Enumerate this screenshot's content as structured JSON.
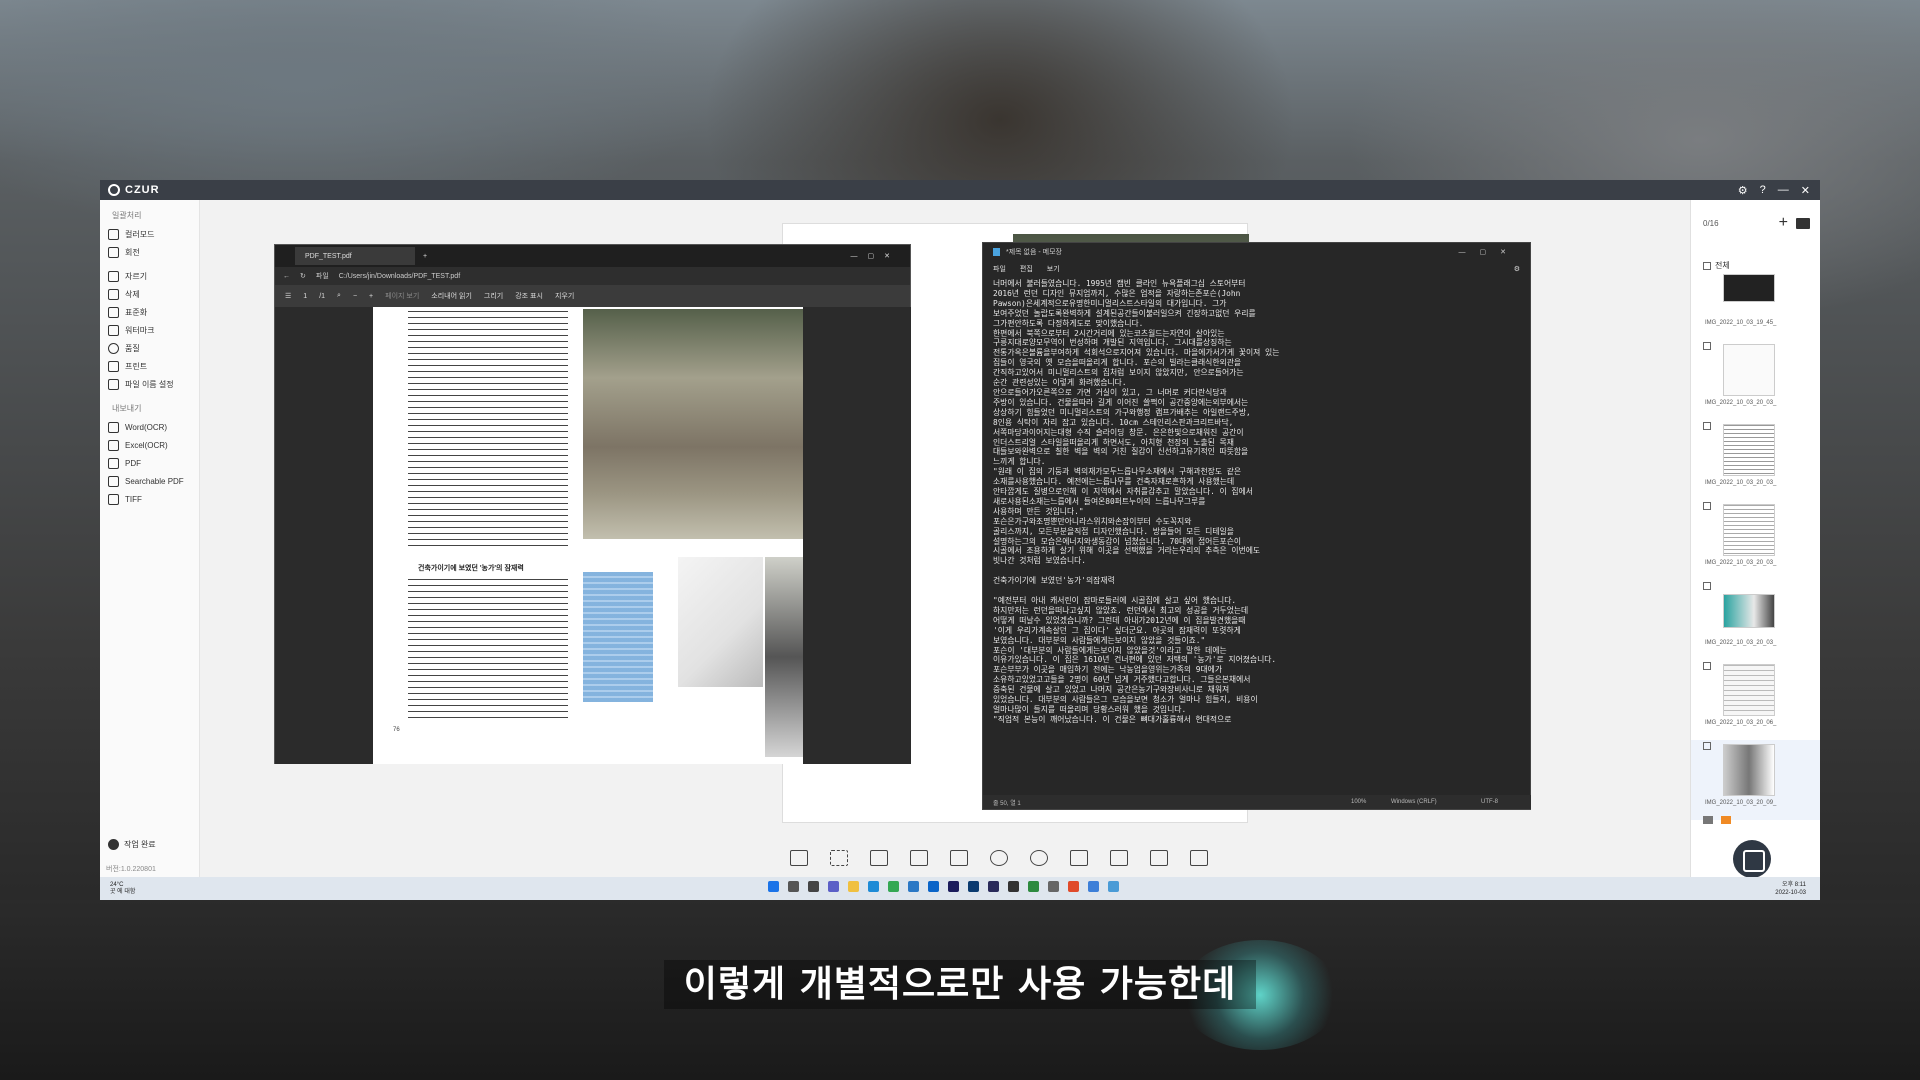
{
  "app": {
    "brand": "CZUR",
    "window_controls": [
      "⚙",
      "?",
      "—",
      "✕"
    ]
  },
  "sidebar": {
    "processing_header": "일괄처리",
    "processing_items": [
      "컬러모드",
      "회전",
      "자르기",
      "삭제",
      "표준화",
      "워터마크",
      "품질",
      "프린트",
      "파일 이름 설정"
    ],
    "export_header": "내보내기",
    "export_items": [
      "Word(OCR)",
      "Excel(OCR)",
      "PDF",
      "Searchable PDF",
      "TIFF"
    ],
    "task_done": "작업 완료",
    "version": "버전:1.0.220801"
  },
  "thumbnails": {
    "count": "0/16",
    "select_all": "전체",
    "items": [
      "IMG_2022_10_03_19_45_",
      "IMG_2022_10_03_20_03_",
      "IMG_2022_10_03_20_03_",
      "IMG_2022_10_03_20_03_",
      "IMG_2022_10_03_20_03_",
      "IMG_2022_10_03_20_06_",
      "IMG_2022_10_03_20_09_"
    ],
    "scan_label": "스캔"
  },
  "pdf_viewer": {
    "tab_title": "PDF_TEST.pdf",
    "address_prefix": "파일",
    "address": "C:/Users/jin/Downloads/PDF_TEST.pdf",
    "page_number": "1",
    "page_total": "/1",
    "tools": [
      "페이지 보기",
      "소리내어 읽기",
      "그리기",
      "강조 표시",
      "지우기"
    ],
    "heading": "건축가이기에 보였던 '농가'의 잠재력",
    "page_footer": "76"
  },
  "notepad": {
    "title": "*제목 없음 - 메모장",
    "menu": [
      "파일",
      "편집",
      "보기"
    ],
    "body": "너머에서 불러들였습니다. 1995년 캠빈 클라인 뉴욕플래그십 스토어부터\n2016년 런던 디자인 뮤지엄까지, 수많은 업적을 자랑하는존포슨(John\nPawson)은세계적으로유명한미니멀리스트스타일의 대가입니다. 그가\n보여주었던 놀랍도록완벽하게 설계된공간들이불러일으켜 긴장하고없던 우리를\n그가편안하도록 다정하게도로 맞이했습니다.\n한편에서 북쪽으로부터 2시간거리에 있는코츠월드는자연이 살아있는\n구릉지대로양모무역이 번성하며 개발된 지역입니다. 그시대를상징하는\n전통가옥은볼륨을부여하게 석회석으로지어져 있습니다. 마을에가서가게 꽃이져 있는\n집들이 영국의 옛 모습을떠올리게 합니다. 포슨의 빌라는클래식한외관을\n간직하고있어서 미니멀리스트의 집처럼 보이지 않았지만, 안으로들어가는\n순간 관련성있는 이렇게 화려했습니다.\n안으로들어가오른쪽으로 가면 거실이 있고, 그 너머로 커다란식당과\n주방이 있습니다. 건물을따라 길게 이어진 쓸쩍이 공간중앙에는외부에서는\n상상하기 힘들었던 미니멀리스트의 가구와행정 램프가배추는 아일랜드주방,\n8인용 식탁이 자리 잡고 있습니다. 10cm 스테인리스판과크리트바닥,\n서쪽마당과이어지는대형 수직 슬라이딩 창문. 은은한빛으로채워진 공간이\n인더스트리얼 스타일을떠올리게 하면서도, 아치형 천장의 노출된 목재\n대들보와완벽으로 칠한 벽을 벽의 거친 질감이 신선하고유기적인 따뜻함을\n느끼게 합니다.\n\"원래 이 집의 기둥과 벽의재가모두느릅나무소재에서 구해과천장도 같은\n소재를사용했습니다. 예전에는느릅나무를 건축자재로흔하게 사용했는데\n안타깝게도 질병으로인해 이 지역에서 자취를감추고 말았습니다. 이 집에서\n새로사용된소재는느릅에서 들여온80퍼트누이의 느릅나무그루를\n사용하며 만든 것입니다.\"\n포슨은가구와조명뿐만아니라스위치와손잡이부터 수도꼭지와\n골리스까지, 모든부분을직접 디자인했습니다. 방을들어 모든 디테일을\n설명하는그의 모습은에너지와생동감이 넘쳤습니다. 70대에 접어든포슨이\n시골에서 조용하게 살기 위해 이곳을 선택했을 거라는우리의 추측은 이번에도\n빗나간 것처럼 보였습니다.\n\n건축가이기에 보였던'농가'의잠재력\n\n\"예전부터 아내 캐서린이 잠마로들러에 시골집에 살고 싶어 했습니다.\n하지만저는 런던을떠나고싶지 않았죠. 런던에서 최고의 성공을 거두었는데\n어떻게 떠날수 있었겠습니까? 그런데 아내가2012년에 이 집을발견했을때\n'이게 우리가계속살던 그 집이다' 싶더군요. 아곳의 잠재력이 또렷하게\n보였습니다. 대부분의 사람들에게는보이지 않았을 것들이죠.\"\n포슨이 '대부분의 사람들에게는보이지 않았을것'이라고 말한 데에는\n이유가있습니다. 이 집은 1610년 건너편에 있던 저택의 '농가'로 지어졌습니다.\n포슨부부가 이곳을 매입하기 전에는 낙농업을영위는가족의 9대에가\n소유하고있었고고들을 2명이 60년 넘게 거주했다고합니다. 그들은본채에서\n증축된 건물에 살고 있었고 나머지 공간은농기구와장비사니로 채워져\n있었습니다. 대부분의 사람들은그 모습을보면 청소가 얼마나 힘들지, 비용이\n얼마나많이 들지를 떠올리며 당황스러워 했을 것입니다.\n\"직업적 본능이 깨어났습니다. 이 건물은 뼈대가훌륭해서 현대적으로",
    "status": [
      "줄 50, 열 1",
      "100%",
      "Windows (CRLF)",
      "UTF-8"
    ]
  },
  "taskbar": {
    "weather_temp": "24°C",
    "weather_desc": "곳 에 대함",
    "time": "오후 8:11",
    "date": "2022-10-03"
  },
  "subtitle": "이렇게 개별적으로만 사용 가능한데"
}
